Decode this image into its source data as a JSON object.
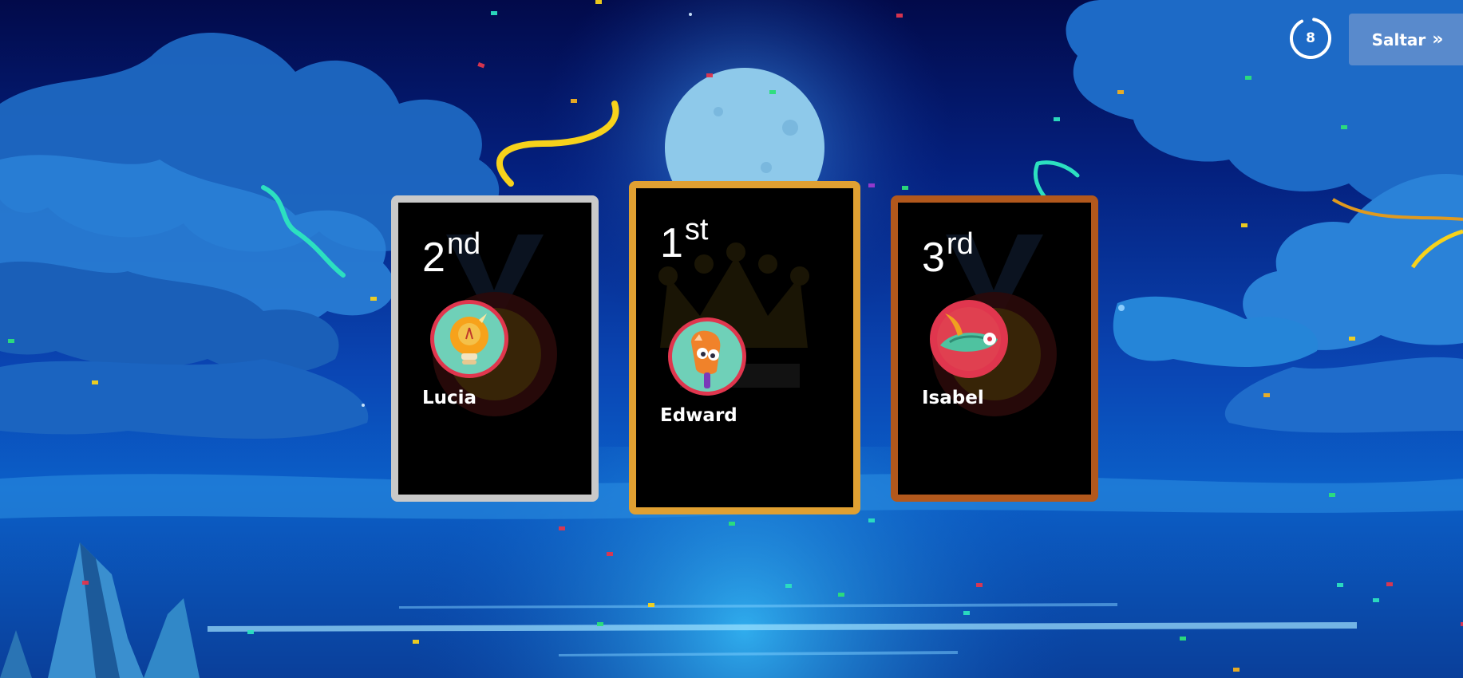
{
  "timer": {
    "value": "8"
  },
  "skip_button": {
    "label": "Saltar"
  },
  "podium": [
    {
      "rank_number": "2",
      "rank_suffix": "nd",
      "name": "Lucia",
      "avatar_icon": "lightbulb-icon",
      "frame": "silver"
    },
    {
      "rank_number": "1",
      "rank_suffix": "st",
      "name": "Edward",
      "avatar_icon": "popsicle-icon",
      "frame": "gold"
    },
    {
      "rank_number": "3",
      "rank_suffix": "rd",
      "name": "Isabel",
      "avatar_icon": "feathered-hat-icon",
      "frame": "bronze"
    }
  ],
  "colors": {
    "gold": "#e0a032",
    "silver": "#c9c9c9",
    "bronze": "#b2581c",
    "avatar_ring": "#e0364e",
    "avatar_fill": "#6fd0b8"
  }
}
